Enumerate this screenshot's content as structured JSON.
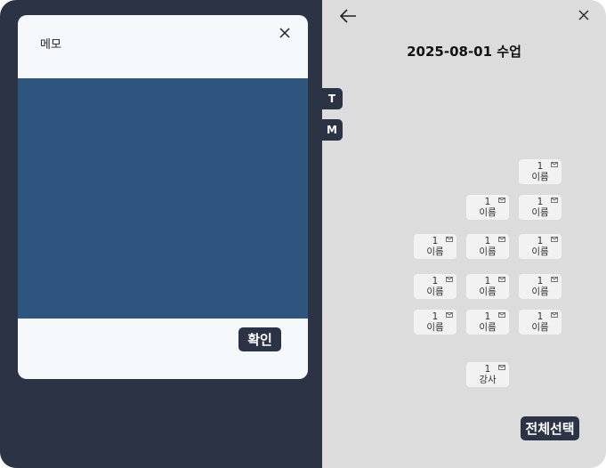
{
  "memo_modal": {
    "title": "메모",
    "confirm_label": "확인"
  },
  "header": {
    "title": "2025-08-01 수업"
  },
  "side_tabs": [
    "T",
    "M"
  ],
  "seats": [
    {
      "number": "1",
      "name": "이름"
    },
    {
      "number": "1",
      "name": "이름"
    },
    {
      "number": "1",
      "name": "이름"
    },
    {
      "number": "1",
      "name": "이름"
    },
    {
      "number": "1",
      "name": "이름"
    },
    {
      "number": "1",
      "name": "이름"
    },
    {
      "number": "1",
      "name": "이름"
    },
    {
      "number": "1",
      "name": "이름"
    },
    {
      "number": "1",
      "name": "이름"
    },
    {
      "number": "1",
      "name": "이름"
    },
    {
      "number": "1",
      "name": "이름"
    },
    {
      "number": "1",
      "name": "이름"
    },
    {
      "number": "1",
      "name": "강사"
    }
  ],
  "footer": {
    "select_all_label": "전체선택"
  },
  "colors": {
    "dark": "#2c3345",
    "memo_area": "#2d557d",
    "panel_bg": "#dcdcdc",
    "seat_bg": "#f2f2f2",
    "card_bg": "#f5f9fc"
  },
  "icons": [
    "close-icon",
    "back-arrow-icon",
    "memo-icon"
  ]
}
